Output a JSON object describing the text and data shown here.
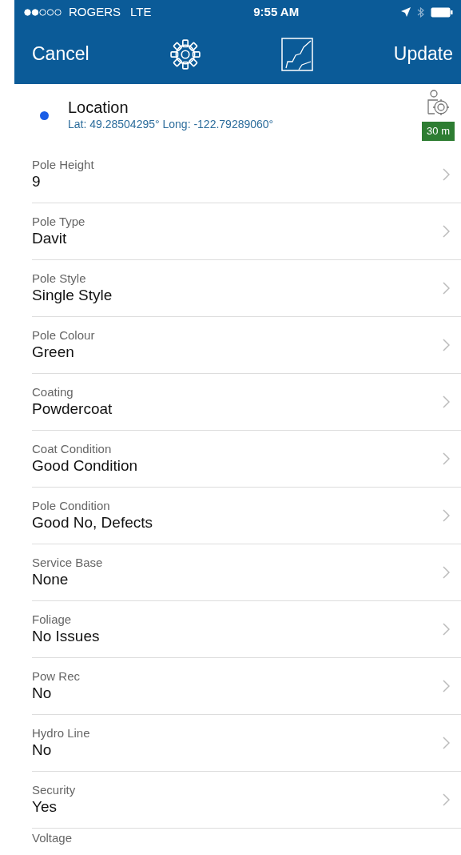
{
  "status_bar": {
    "carrier": "ROGERS",
    "network": "LTE",
    "time": "9:55 AM"
  },
  "nav_bar": {
    "cancel": "Cancel",
    "update": "Update"
  },
  "location": {
    "title": "Location",
    "coords": "Lat: 49.28504295° Long: -122.79289060°",
    "accuracy": "30 m"
  },
  "fields": [
    {
      "label": "Pole Height",
      "value": "9"
    },
    {
      "label": "Pole Type",
      "value": "Davit"
    },
    {
      "label": "Pole Style",
      "value": "Single Style"
    },
    {
      "label": "Pole Colour",
      "value": "Green"
    },
    {
      "label": "Coating",
      "value": "Powdercoat"
    },
    {
      "label": "Coat Condition",
      "value": "Good Condition"
    },
    {
      "label": "Pole Condition",
      "value": "Good No, Defects"
    },
    {
      "label": "Service Base",
      "value": "None"
    },
    {
      "label": "Foliage",
      "value": "No Issues"
    },
    {
      "label": "Pow Rec",
      "value": "No"
    },
    {
      "label": "Hydro Line",
      "value": "No"
    },
    {
      "label": "Security",
      "value": "Yes"
    },
    {
      "label": "Voltage"
    }
  ]
}
